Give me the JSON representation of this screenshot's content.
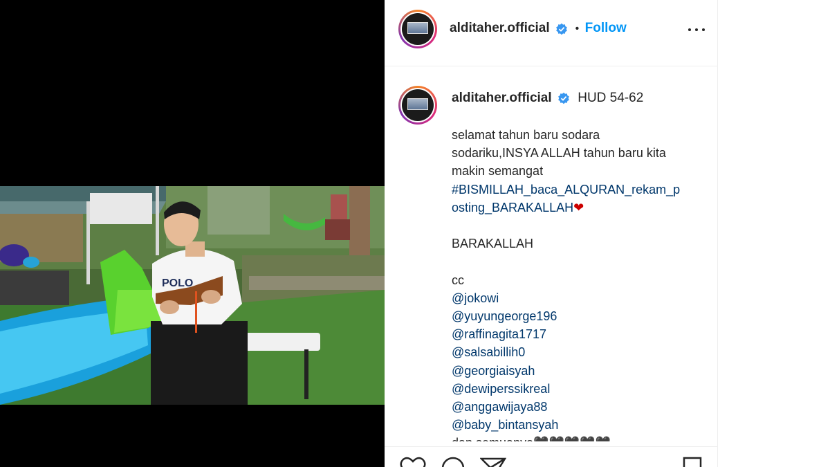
{
  "post": {
    "username": "alditaher.official",
    "follow_label": "Follow",
    "separator": "•"
  },
  "caption": {
    "title": "HUD 54-62",
    "lines": [
      "selamat tahun baru sodara",
      "sodariku,INSYA ALLAH tahun baru kita",
      "makin semangat"
    ],
    "hashtag_line1": "#BISMILLAH_baca_ALQURAN_rekam_p",
    "hashtag_line2": "osting_BARAKALLAH",
    "heart": "❤",
    "barakallah": "BARAKALLAH",
    "cc": "cc",
    "mentions": [
      "@jokowi",
      "@yuyungeorge196",
      "@raffinagita1717",
      "@salsabillih0",
      "@georgiaisyah",
      "@dewiperssikreal",
      "@anggawijaya88",
      "@baby_bintansyah"
    ],
    "last_line": "dan semuanya🖤🖤🖤🖤🖤"
  },
  "icons": {
    "verified": "verified-badge-icon",
    "more": "more-options-icon",
    "like": "heart-icon",
    "comment": "comment-icon",
    "share": "send-icon",
    "save": "bookmark-icon"
  },
  "colors": {
    "accent": "#0095f6",
    "link": "#00376b",
    "verified": "#3897f0"
  }
}
